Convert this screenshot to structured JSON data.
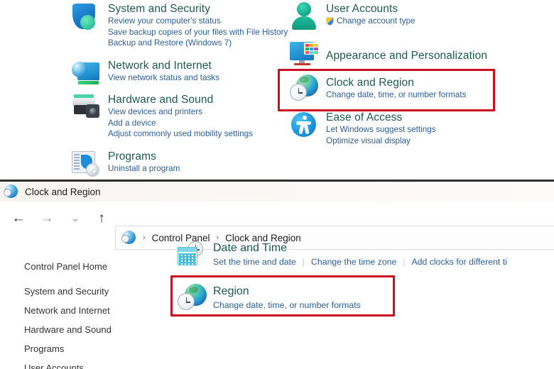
{
  "top_panel": {
    "categories_left": [
      {
        "icon": "shield-icon",
        "title": "System and Security",
        "links": [
          "Review your computer's status",
          "Save backup copies of your files with File History",
          "Backup and Restore (Windows 7)"
        ]
      },
      {
        "icon": "network-globe-monitor-icon",
        "title": "Network and Internet",
        "links": [
          "View network status and tasks"
        ]
      },
      {
        "icon": "printer-icon",
        "title": "Hardware and Sound",
        "links": [
          "View devices and printers",
          "Add a device",
          "Adjust commonly used mobility settings"
        ]
      },
      {
        "icon": "programs-icon",
        "title": "Programs",
        "links": [
          "Uninstall a program"
        ]
      }
    ],
    "categories_right": [
      {
        "icon": "user-person-icon",
        "title": "User Accounts",
        "links": [
          "Change account type"
        ],
        "link_icon": "uac-shield-icon"
      },
      {
        "icon": "appearance-monitor-icon",
        "title": "Appearance and Personalization",
        "links": []
      },
      {
        "icon": "clock-globe-icon",
        "title": "Clock and Region",
        "links": [
          "Change date, time, or number formats"
        ],
        "highlighted": true
      },
      {
        "icon": "ease-of-access-icon",
        "title": "Ease of Access",
        "links": [
          "Let Windows suggest settings",
          "Optimize visual display"
        ]
      }
    ]
  },
  "bottom_window": {
    "titlebar": {
      "icon": "clock-globe-icon",
      "title": "Clock and Region"
    },
    "nav": {
      "back": "←",
      "forward": "→",
      "recent": "⌄",
      "up": "↑"
    },
    "address": {
      "icon": "clock-globe-icon",
      "separator": "›",
      "crumbs": [
        "Control Panel",
        "Clock and Region"
      ]
    },
    "sidebar": {
      "home": "Control Panel Home",
      "items": [
        "System and Security",
        "Network and Internet",
        "Hardware and Sound",
        "Programs",
        "User Accounts"
      ]
    },
    "sections": [
      {
        "icon": "calendar-clock-icon",
        "title": "Date and Time",
        "links": [
          "Set the time and date",
          "Change the time zone",
          "Add clocks for different ti"
        ]
      },
      {
        "icon": "region-globe-clock-icon",
        "title": "Region",
        "links": [
          "Change date, time, or number formats"
        ],
        "highlighted": true
      }
    ]
  },
  "colors": {
    "heading": "#1c5c4c",
    "link": "#2b5f9e",
    "highlight_box": "#cc0e1e",
    "sidebar_text": "#343434",
    "titlebar_bg": "#faf7f4"
  },
  "tile_colors": [
    "#e8453c",
    "#f5a623",
    "#f2c94c",
    "#27ae60",
    "#2d9cdb",
    "#9b51e0",
    "#eb5757",
    "#56ccf2",
    "#6fcf97"
  ]
}
